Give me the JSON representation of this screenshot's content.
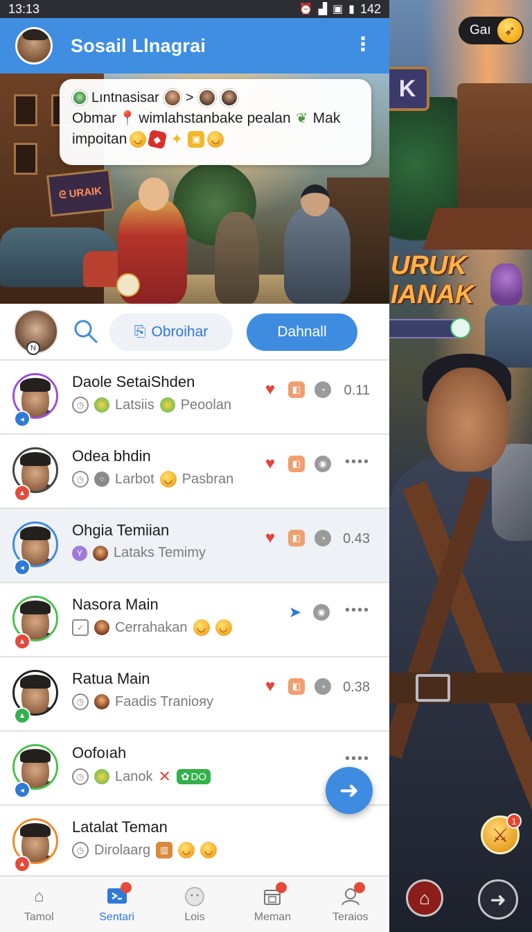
{
  "status_bar": {
    "time": "13:13",
    "battery": "142"
  },
  "app_bar": {
    "title": "Sosail Llnagrai"
  },
  "message_card": {
    "from": "Lıntnasisar",
    "arrow": ">",
    "line1": "Obmar",
    "line1_rest": "wimlahstanbake pealan",
    "line1_tail": "Mak",
    "line2": "impoitan"
  },
  "actions": {
    "outline_label": "Obroihar",
    "primary_label": "Dahnall"
  },
  "friends": [
    {
      "name": "Daole SetaiShden",
      "sub1": "Latsiis",
      "sub2": "Peoolan",
      "meta": "0.11",
      "ring": "#9b4fd6",
      "badge": "#2f7ad8",
      "sub_icon": "green"
    },
    {
      "name": "Odea bhdin",
      "sub1": "Larbot",
      "sub2": "Pasbran",
      "meta": "••••",
      "ring": "#444444",
      "badge": "#e54a3a",
      "sub_icon": "gray"
    },
    {
      "name": "Ohgia Temiian",
      "sub1": "Lataks Temimy",
      "sub2": "",
      "meta": "0.43",
      "ring": "#3e8ce0",
      "badge": "#2f7ad8",
      "sub_icon": "brown"
    },
    {
      "name": "Nasora Main",
      "sub1": "Cerrahakan",
      "sub2": "",
      "meta": "••••",
      "ring": "#4cc04e",
      "badge": "#e54a3a",
      "sub_icon": "brown"
    },
    {
      "name": "Ratua Main",
      "sub1": "Faadis Traniояy",
      "sub2": "",
      "meta": "0.38",
      "ring": "#222222",
      "badge": "#33b14c",
      "sub_icon": "brown"
    },
    {
      "name": "Oofoıah",
      "sub1": "Lanok",
      "sub2": "DO",
      "meta": "••••",
      "ring": "#4cc04e",
      "badge": "#2f7ad8",
      "sub_icon": "green"
    },
    {
      "name": "Latalat Teman",
      "sub1": "Dirolaarg",
      "sub2": "",
      "meta": "",
      "ring": "#f08a2a",
      "badge": "#e54a3a",
      "sub_icon": "none"
    }
  ],
  "bottom_nav": [
    {
      "label": "Tamol",
      "icon": "home-icon",
      "active": false
    },
    {
      "label": "Sentari",
      "icon": "chat-icon",
      "active": true
    },
    {
      "label": "Lois",
      "icon": "bubble-icon",
      "active": false
    },
    {
      "label": "Meman",
      "icon": "calendar-icon",
      "active": false
    },
    {
      "label": "Teraios",
      "icon": "friends-icon",
      "active": false
    }
  ],
  "game_overlay": {
    "pill_label": "Gaı",
    "sign_top": "K",
    "sign_mid": "URUK\nIANAK",
    "sword_badge": "1"
  }
}
